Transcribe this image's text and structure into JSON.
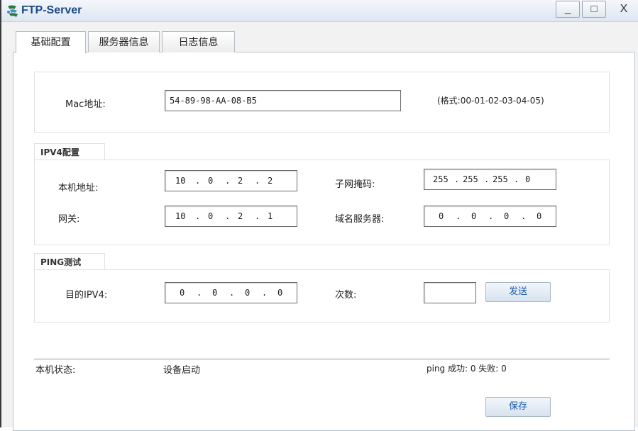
{
  "window": {
    "title": "FTP-Server",
    "min_label": "_",
    "max_label": "□",
    "close_label": "X"
  },
  "tabs": [
    {
      "label": "基础配置"
    },
    {
      "label": "服务器信息"
    },
    {
      "label": "日志信息"
    }
  ],
  "mac": {
    "label": "Mac地址:",
    "value": "54-89-98-AA-08-B5",
    "hint": "(格式:00-01-02-03-04-05)"
  },
  "ipv4": {
    "title": "IPV4配置",
    "local_label": "本机地址:",
    "local": [
      "10",
      ".",
      "0",
      ".",
      "2",
      ".",
      "2"
    ],
    "mask_label": "子网掩码:",
    "mask": [
      "255",
      ".",
      "255",
      ".",
      "255",
      ".",
      "0"
    ],
    "gateway_label": "网关:",
    "gateway": [
      "10",
      ".",
      "0",
      ".",
      "2",
      ".",
      "1"
    ],
    "dns_label": "域名服务器:",
    "dns": [
      "0",
      ".",
      "0",
      ".",
      "0",
      ".",
      "0"
    ]
  },
  "ping": {
    "title": "PING测试",
    "dest_label": "目的IPV4:",
    "dest": [
      "0",
      ".",
      "0",
      ".",
      "0",
      ".",
      "0"
    ],
    "count_label": "次数:",
    "count_value": "",
    "send_label": "发送"
  },
  "status": {
    "label": "本机状态:",
    "value": "设备启动",
    "ping_result": "ping 成功: 0 失败: 0"
  },
  "save_label": "保存"
}
